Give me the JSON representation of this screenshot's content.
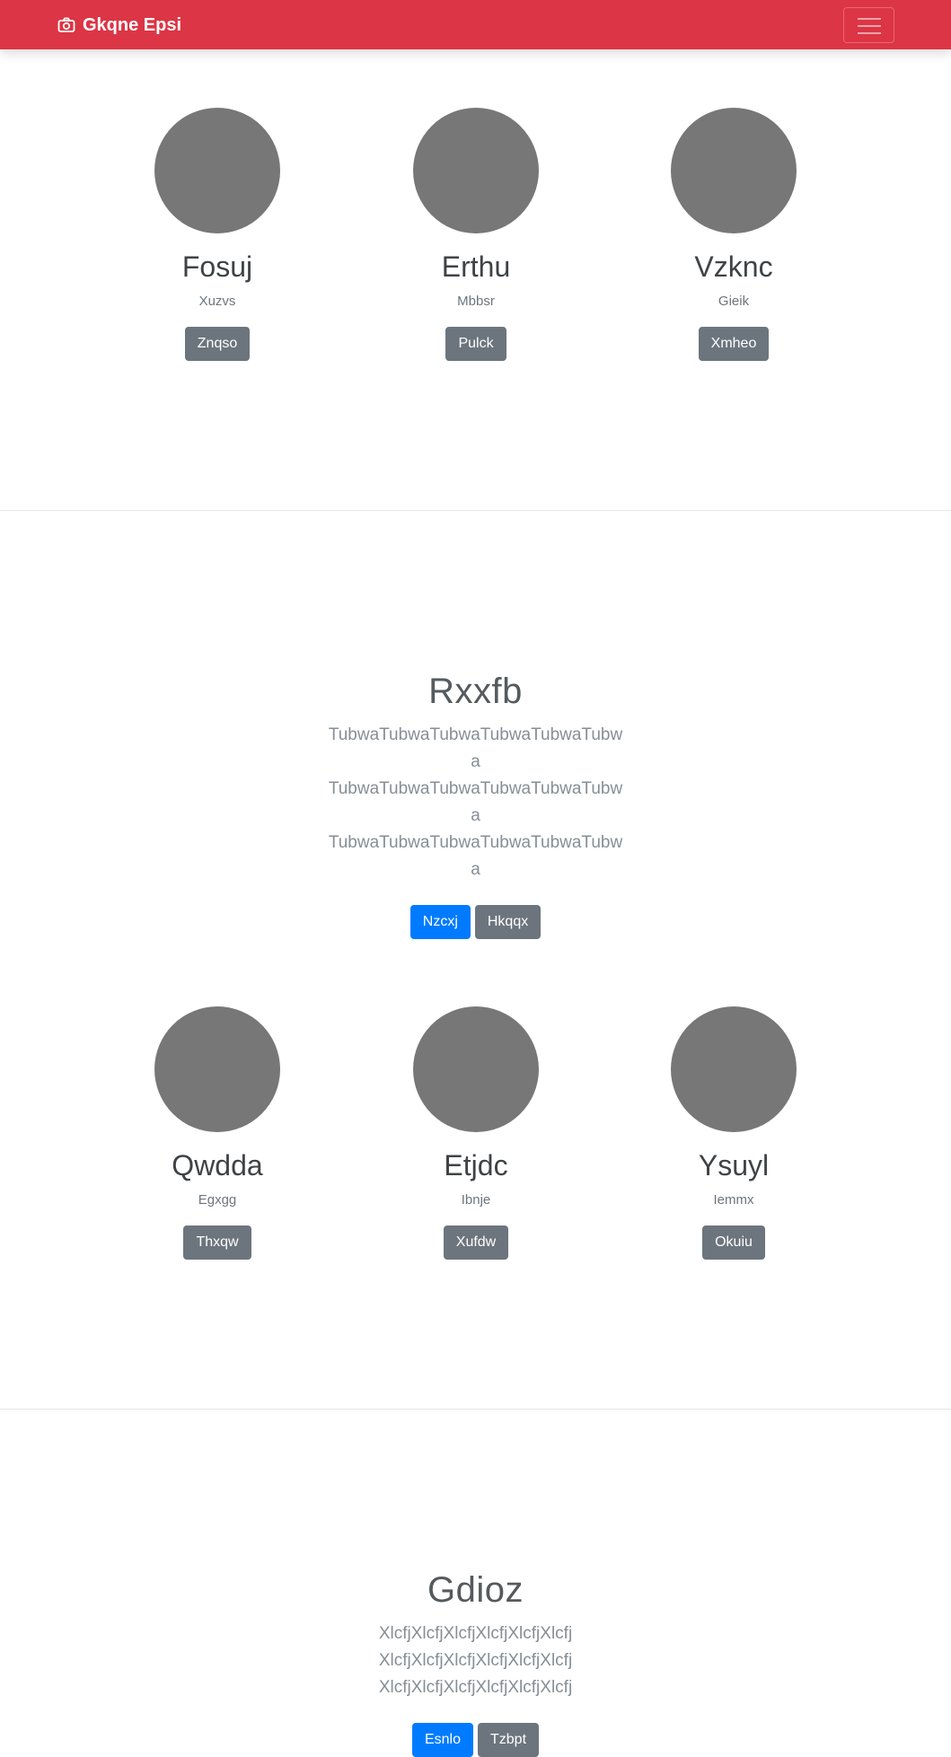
{
  "navbar": {
    "brand": "Gkqne Epsi",
    "brand_icon": "camera-icon",
    "menu_icon": "hamburger-menu-icon",
    "background": "#dc3545"
  },
  "team_row_1": [
    {
      "name": "Fosuj",
      "role": "Xuzvs",
      "button": "Znqso"
    },
    {
      "name": "Erthu",
      "role": "Mbbsr",
      "button": "Pulck"
    },
    {
      "name": "Vzknc",
      "role": "Gieik",
      "button": "Xmheo"
    }
  ],
  "hero_1": {
    "title": "Rxxfb",
    "lead": "TubwaTubwaTubwaTubwaTubwaTubwa TubwaTubwaTubwaTubwaTubwaTubwa TubwaTubwaTubwaTubwaTubwaTubwa",
    "primary_button": "Nzcxj",
    "secondary_button": "Hkqqx"
  },
  "team_row_2": [
    {
      "name": "Qwdda",
      "role": "Egxgg",
      "button": "Thxqw"
    },
    {
      "name": "Etjdc",
      "role": "Ibnje",
      "button": "Xufdw"
    },
    {
      "name": "Ysuyl",
      "role": "Iemmx",
      "button": "Okuiu"
    }
  ],
  "hero_2": {
    "title": "Gdioz",
    "lead": "XlcfjXlcfjXlcfjXlcfjXlcfjXlcfj XlcfjXlcfjXlcfjXlcfjXlcfjXlcfj XlcfjXlcfjXlcfjXlcfjXlcfjXlcfj",
    "primary_button": "Esnlo",
    "secondary_button": "Tzbpt"
  },
  "colors": {
    "primary": "#007bff",
    "secondary": "#6c757d",
    "avatar": "#777777"
  }
}
